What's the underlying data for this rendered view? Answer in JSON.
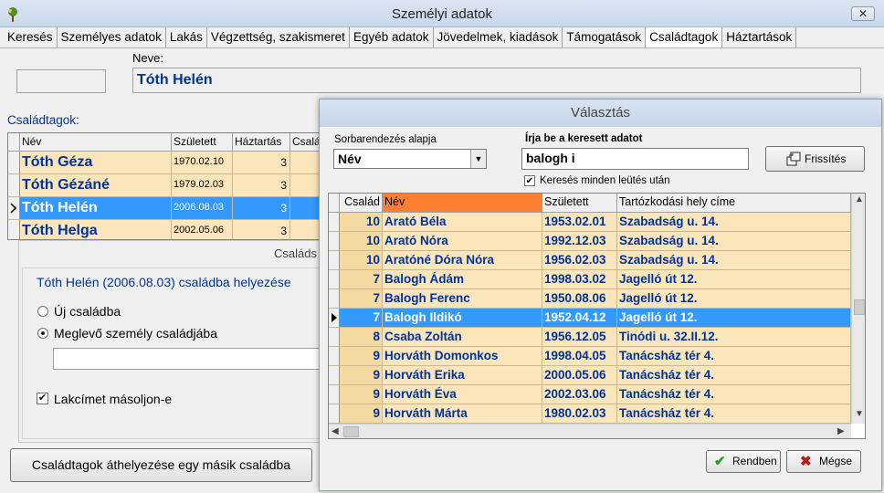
{
  "window": {
    "title": "Személyi adatok",
    "close_symbol": "✕"
  },
  "tabs": [
    {
      "label": "Keresés"
    },
    {
      "label": "Személyes adatok"
    },
    {
      "label": "Lakás"
    },
    {
      "label": "Végzettség, szakismeret"
    },
    {
      "label": "Egyéb adatok"
    },
    {
      "label": "Jövedelmek, kiadások"
    },
    {
      "label": "Támogatások"
    },
    {
      "label": "Családtagok",
      "active": true
    },
    {
      "label": "Háztartások"
    }
  ],
  "person": {
    "neve_label": "Neve:",
    "name": "Tóth Helén"
  },
  "family": {
    "label": "Családtagok:",
    "headers": {
      "nev": "Név",
      "szuletett": "Született",
      "haztartas": "Háztartás",
      "csalad": "Csalá"
    },
    "rows": [
      {
        "nev": "Tóth Géza",
        "szuletett": "1970.02.10",
        "haztartas": "3"
      },
      {
        "nev": "Tóth Gézáné",
        "szuletett": "1979.02.03",
        "haztartas": "3"
      },
      {
        "nev": "Tóth Helén",
        "szuletett": "2006.08.03",
        "haztartas": "3",
        "selected": true
      },
      {
        "nev": "Tóth Helga",
        "szuletett": "2002.05.06",
        "haztartas": "3"
      }
    ]
  },
  "placement_panel": {
    "title": "Családs",
    "description": "Tóth Helén (2006.08.03) családba helyezése",
    "option_new": "Új családba",
    "option_existing": "Meglevő személy családjába",
    "copy_address": "Lakcímet másoljon-e",
    "move_button": "Családtagok áthelyezése egy másik családba"
  },
  "dialog": {
    "title": "Választás",
    "sort_label": "Sorbarendezés alapja",
    "sort_value": "Név",
    "search_label": "Írja be a keresett adatot",
    "search_value": "balogh i",
    "search_each_key": "Keresés minden leütés után",
    "refresh_button": "Frissítés",
    "ok_button": "Rendben",
    "cancel_button": "Mégse",
    "grid_headers": {
      "csalad": "Család",
      "nev": "Név",
      "szuletett": "Született",
      "hely": "Tartózkodási hely címe"
    },
    "rows": [
      {
        "csalad": "10",
        "nev": "Arató Béla",
        "szuletett": "1953.02.01",
        "hely": "Szabadság u. 14."
      },
      {
        "csalad": "10",
        "nev": "Arató Nóra",
        "szuletett": "1992.12.03",
        "hely": "Szabadság u. 14."
      },
      {
        "csalad": "10",
        "nev": "Aratóné Dóra Nóra",
        "szuletett": "1956.02.03",
        "hely": "Szabadság u. 14."
      },
      {
        "csalad": "7",
        "nev": "Balogh Ádám",
        "szuletett": "1998.03.02",
        "hely": "Jagelló út 12."
      },
      {
        "csalad": "7",
        "nev": "Balogh Ferenc",
        "szuletett": "1950.08.06",
        "hely": "Jagelló út 12."
      },
      {
        "csalad": "7",
        "nev": "Balogh Ildikó",
        "szuletett": "1952.04.12",
        "hely": "Jagelló út 12.",
        "selected": true
      },
      {
        "csalad": "8",
        "nev": "Csaba Zoltán",
        "szuletett": "1956.12.05",
        "hely": "Tinódi u. 32.II.12."
      },
      {
        "csalad": "9",
        "nev": "Horváth Domonkos",
        "szuletett": "1998.04.05",
        "hely": "Tanácsház tér 4."
      },
      {
        "csalad": "9",
        "nev": "Horváth Erika",
        "szuletett": "2000.05.06",
        "hely": "Tanácsház tér 4."
      },
      {
        "csalad": "9",
        "nev": "Horváth Éva",
        "szuletett": "2002.03.06",
        "hely": "Tanácsház tér 4."
      },
      {
        "csalad": "9",
        "nev": "Horváth Márta",
        "szuletett": "1980.02.03",
        "hely": "Tanácsház tér 4."
      }
    ]
  },
  "colors": {
    "row_bg": "#fbe6bb",
    "selection": "#3399ff",
    "name_text": "#003399",
    "active_header": "#ff7f32"
  }
}
